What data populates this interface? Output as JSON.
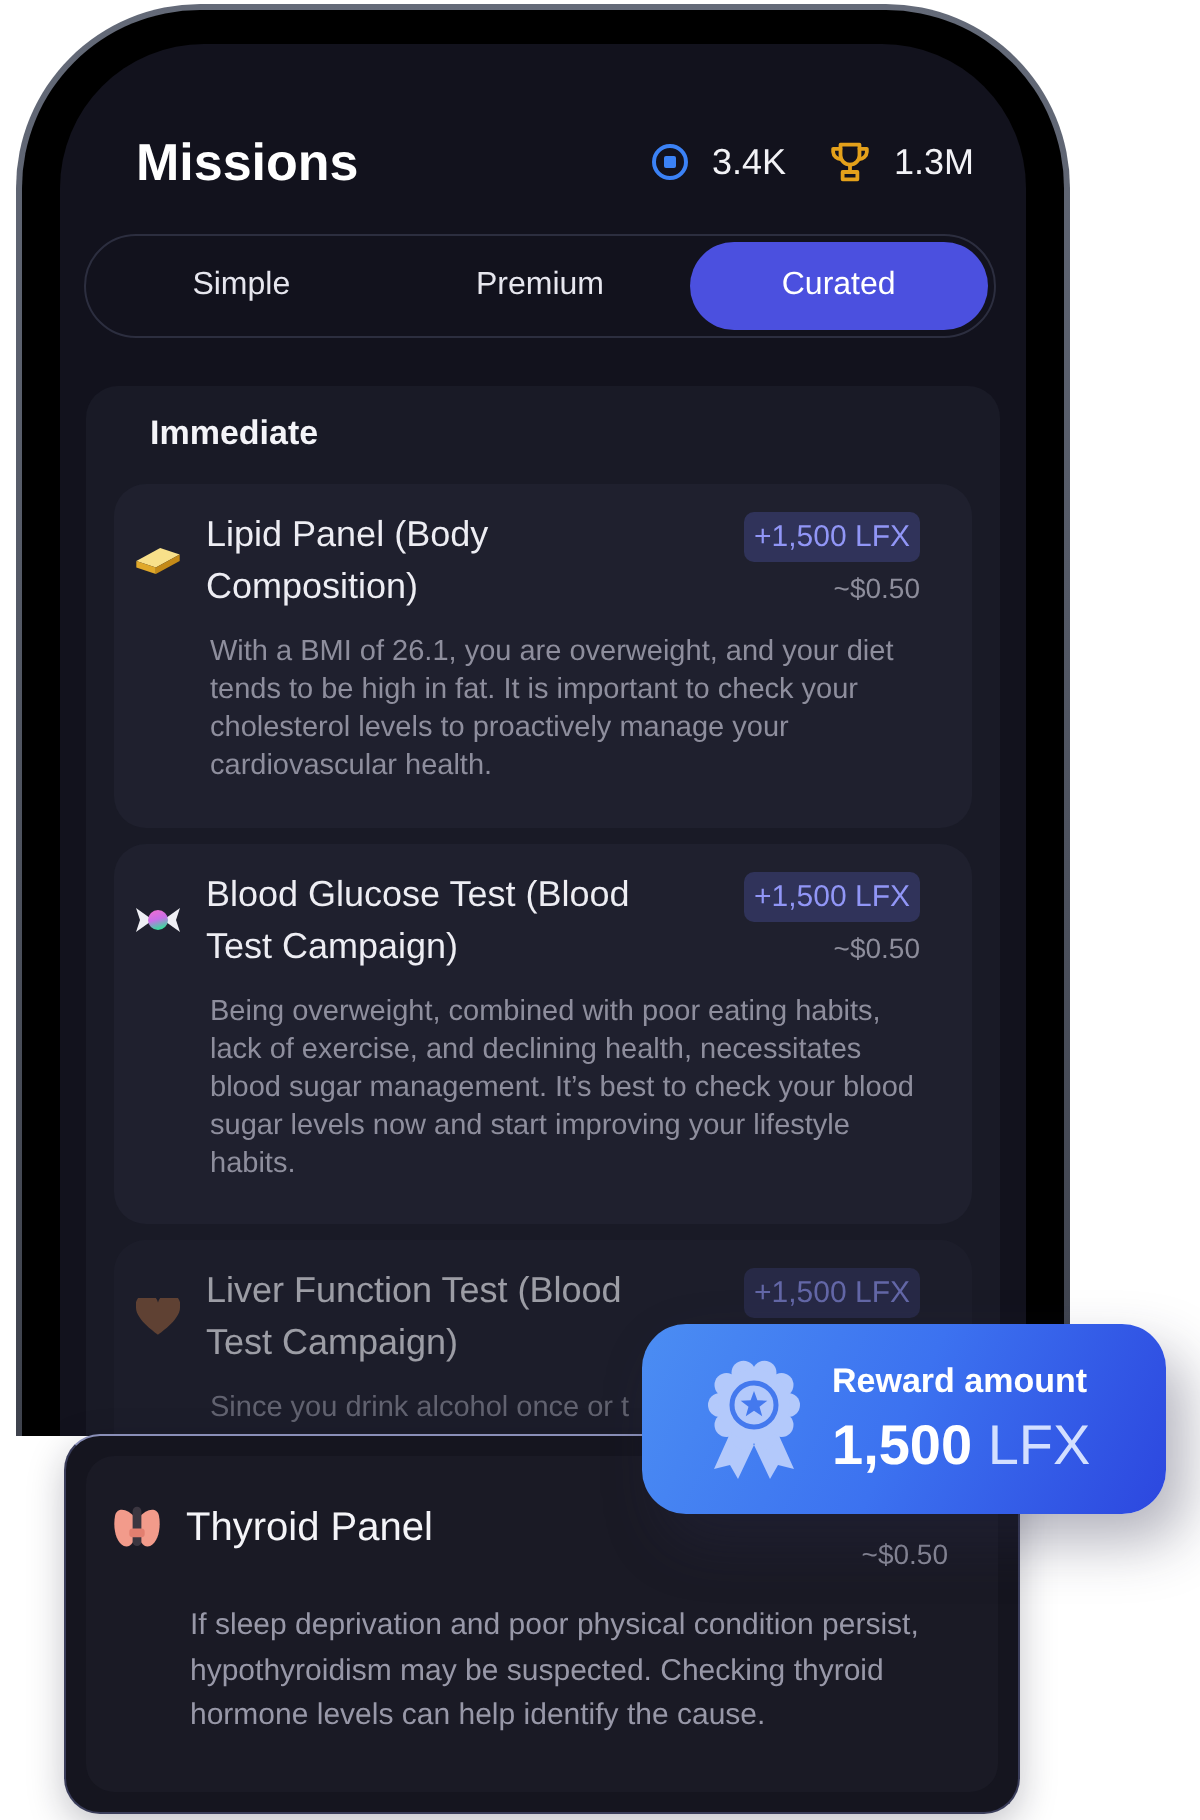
{
  "header": {
    "title": "Missions",
    "stats": [
      {
        "kind": "coins",
        "value": "3.4K"
      },
      {
        "kind": "trophies",
        "value": "1.3M"
      }
    ]
  },
  "tabs": [
    {
      "label": "Simple",
      "selected": false
    },
    {
      "label": "Premium",
      "selected": false
    },
    {
      "label": "Curated",
      "selected": true
    }
  ],
  "section": {
    "title": "Immediate",
    "missions": [
      {
        "title": "Lipid Panel (Body Composition)",
        "reward": "+1,500 LFX",
        "price": "~$0.50",
        "description": "With a BMI of 26.1, you are overweight, and your diet tends to be high in fat. It is important to check your cholesterol levels to proactively manage your cardiovascular health.",
        "dimmed": false
      },
      {
        "title": "Blood Glucose Test (Blood Test Campaign)",
        "reward": "+1,500 LFX",
        "price": "~$0.50",
        "description": "Being overweight, combined with poor eating habits, lack of exercise, and declining health, necessitates blood sugar management. It’s best to check your blood sugar levels now and start improving your lifestyle habits.",
        "dimmed": false
      },
      {
        "title": "Liver Function Test (Blood Test Campaign)",
        "reward": "+1,500 LFX",
        "description": "Since you drink alcohol once or t",
        "dimmed": true
      }
    ]
  },
  "popout_card": {
    "title": "Thyroid Panel",
    "price": "~$0.50",
    "description": "If sleep deprivation and poor physical condition persist, hypothyroidism may be suspected. Checking thyroid hormone levels can help identify the cause."
  },
  "reward_popup": {
    "label": "Reward amount",
    "amount": "**1,500** LFX"
  }
}
